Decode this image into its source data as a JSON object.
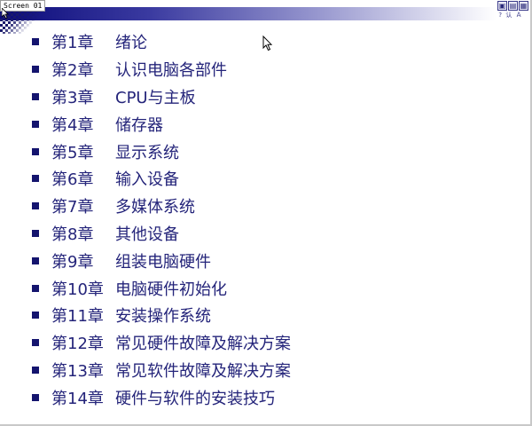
{
  "window": {
    "tab_label": "Screen 01",
    "controls": [
      {
        "name": "zoom-icon",
        "glyph": "◰"
      },
      {
        "name": "restore-icon",
        "glyph": "⊡"
      },
      {
        "name": "fullscreen-icon",
        "glyph": "⛶"
      }
    ],
    "controls_label": "? 认 Ａ"
  },
  "colors": {
    "text": "#24247a",
    "bullet": "#14146e",
    "bar_dark": "#0b0b7a"
  },
  "chapters": [
    {
      "num": "第1章",
      "title": "绪论"
    },
    {
      "num": "第2章",
      "title": "认识电脑各部件"
    },
    {
      "num": "第3章",
      "title": "CPU与主板"
    },
    {
      "num": "第4章",
      "title": "储存器"
    },
    {
      "num": "第5章",
      "title": "显示系统"
    },
    {
      "num": "第6章",
      "title": "输入设备"
    },
    {
      "num": "第7章",
      "title": "多媒体系统"
    },
    {
      "num": "第8章",
      "title": "其他设备"
    },
    {
      "num": "第9章",
      "title": "组装电脑硬件"
    },
    {
      "num": "第10章",
      "title": "电脑硬件初始化"
    },
    {
      "num": "第11章",
      "title": "安装操作系统"
    },
    {
      "num": "第12章",
      "title": "常见硬件故障及解决方案"
    },
    {
      "num": "第13章",
      "title": "常见软件故障及解决方案"
    },
    {
      "num": "第14章",
      "title": "硬件与软件的安装技巧"
    }
  ]
}
